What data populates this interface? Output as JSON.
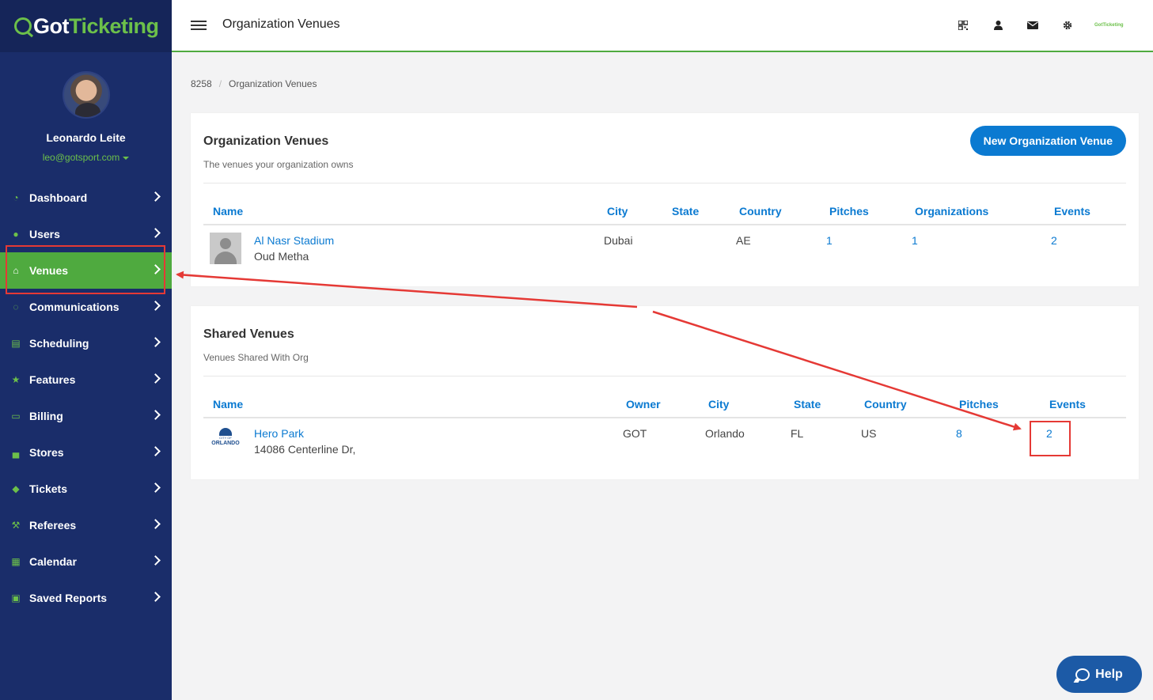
{
  "app": {
    "logo_got": "Got",
    "logo_ticketing": "Ticketing",
    "mini_brand": "GotTicketing"
  },
  "header": {
    "page_title": "Organization Venues"
  },
  "user": {
    "name": "Leonardo Leite",
    "email": "leo@gotsport.com"
  },
  "sidebar": {
    "items": [
      {
        "label": "Dashboard",
        "icon": "dashboard-icon",
        "glyph": "◔"
      },
      {
        "label": "Users",
        "icon": "users-icon",
        "glyph": "●"
      },
      {
        "label": "Venues",
        "icon": "home-icon",
        "glyph": "⌂",
        "active": true
      },
      {
        "label": "Communications",
        "icon": "comments-icon",
        "glyph": "◌"
      },
      {
        "label": "Scheduling",
        "icon": "list-icon",
        "glyph": "▤"
      },
      {
        "label": "Features",
        "icon": "star-icon",
        "glyph": "★"
      },
      {
        "label": "Billing",
        "icon": "credit-card-icon",
        "glyph": "▭"
      },
      {
        "label": "Stores",
        "icon": "shopping-bag-icon",
        "glyph": "▄"
      },
      {
        "label": "Tickets",
        "icon": "ticket-icon",
        "glyph": "◆"
      },
      {
        "label": "Referees",
        "icon": "gavel-icon",
        "glyph": "⚒"
      },
      {
        "label": "Calendar",
        "icon": "calendar-icon",
        "glyph": "▦"
      },
      {
        "label": "Saved Reports",
        "icon": "save-icon",
        "glyph": "▣"
      }
    ]
  },
  "breadcrumb": {
    "id": "8258",
    "current": "Organization Venues"
  },
  "org_venues": {
    "title": "Organization Venues",
    "subtitle": "The venues your organization owns",
    "new_button": "New Organization Venue",
    "columns": [
      "Name",
      "City",
      "State",
      "Country",
      "Pitches",
      "Organizations",
      "Events"
    ],
    "rows": [
      {
        "name": "Al Nasr Stadium",
        "address": "Oud Metha",
        "city": "Dubai",
        "state": "",
        "country": "AE",
        "pitches": "1",
        "organizations": "1",
        "events": "2"
      }
    ]
  },
  "shared_venues": {
    "title": "Shared Venues",
    "subtitle": "Venues Shared With Org",
    "columns": [
      "Name",
      "Owner",
      "City",
      "State",
      "Country",
      "Pitches",
      "Events"
    ],
    "rows": [
      {
        "name": "Hero Park",
        "address": "14086 Centerline Dr,",
        "owner": "GOT",
        "city": "Orlando",
        "state": "FL",
        "country": "US",
        "pitches": "8",
        "events": "2",
        "logo_caption": "CITY OF",
        "logo_word": "ORLANDO"
      }
    ]
  },
  "help": {
    "label": "Help"
  },
  "colors": {
    "sidebar": "#1a2d6a",
    "accent_green": "#4faa3f",
    "link_blue": "#0b7ad1",
    "annotation_red": "#e53935"
  }
}
